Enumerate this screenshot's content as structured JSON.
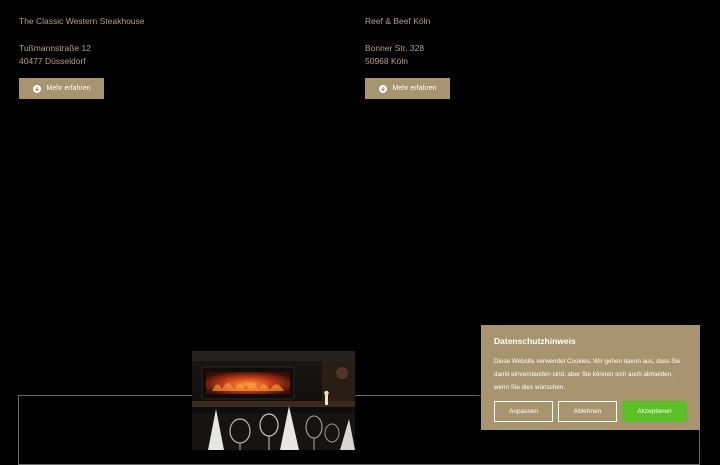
{
  "locations": [
    {
      "title": "The Classic Western Steakhouse",
      "street": "Tußmannstraße 12",
      "city": "40477 Düsseldorf",
      "button_label": "Mehr erfahren",
      "button_icon": "arrow-down-circle-icon"
    },
    {
      "title": "Reef & Beef Köln",
      "street": "Bonner Str. 328",
      "city": "50968 Köln",
      "button_label": "Mehr erfahren",
      "button_icon": "arrow-down-circle-icon"
    }
  ],
  "cookie_banner": {
    "title": "Datenschutzhinweis",
    "text": "Diese Website verwendet Cookies. Wir gehen davon aus, dass Sie damit einverstanden sind, aber Sie können sich auch abmelden, wenn Sie dies wünschen.",
    "customize_label": "Anpassen",
    "decline_label": "Ablehnen",
    "accept_label": "Akzeptieren"
  },
  "colors": {
    "background": "#000000",
    "gold_text": "#b5a07a",
    "gold_button": "#a89570",
    "accept_green": "#5cbf25"
  }
}
